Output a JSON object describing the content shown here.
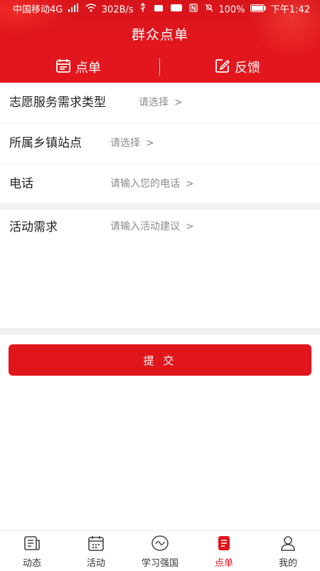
{
  "status_bar": {
    "carrier": "中国移动4G",
    "net_speed": "302B/s",
    "battery": "100%",
    "time": "下午1:42"
  },
  "header": {
    "title": "群众点单",
    "tabs": [
      {
        "label": "点单",
        "icon": "calendar-icon"
      },
      {
        "label": "反馈",
        "icon": "edit-icon"
      }
    ]
  },
  "form": {
    "fields": [
      {
        "label": "志愿服务需求类型",
        "placeholder": "请选择"
      },
      {
        "label": "所属乡镇站点",
        "placeholder": "请选择"
      },
      {
        "label": "电话",
        "placeholder": "请输入您的电话"
      }
    ],
    "demand": {
      "label": "活动需求",
      "placeholder": "请输入活动建议"
    },
    "arrow": ">",
    "submit_label": "提 交"
  },
  "bottom_nav": [
    {
      "label": "动态",
      "icon": "news-icon",
      "active": false
    },
    {
      "label": "活动",
      "icon": "calendar-icon",
      "active": false
    },
    {
      "label": "学习强国",
      "icon": "xuexi-logo-icon",
      "active": false
    },
    {
      "label": "点单",
      "icon": "order-icon",
      "active": true
    },
    {
      "label": "我的",
      "icon": "user-icon",
      "active": false
    }
  ],
  "colors": {
    "brand_red": "#e1151c",
    "placeholder_gray": "#8b8b8b"
  }
}
